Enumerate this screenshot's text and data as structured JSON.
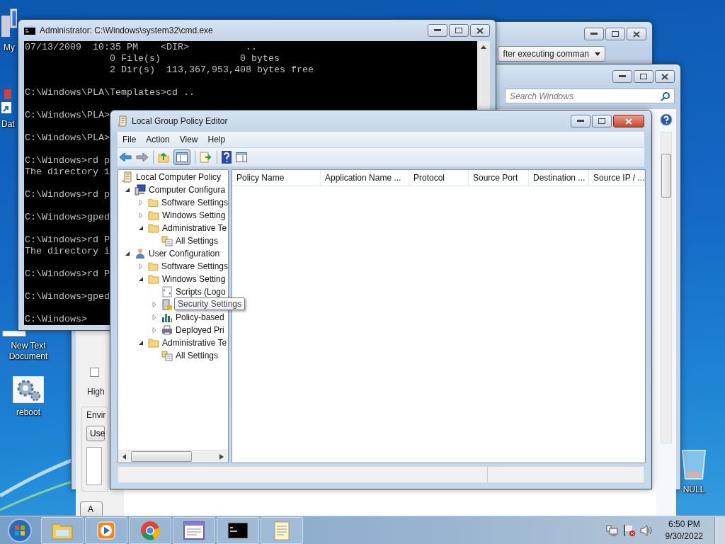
{
  "desktop_icons": [
    {
      "label": "My",
      "kind": "computer"
    },
    {
      "label": "Dat",
      "kind": "shortcut"
    },
    {
      "label": "New Text Document",
      "kind": "text"
    },
    {
      "label": "reboot",
      "kind": "gear"
    },
    {
      "label": "NULL",
      "kind": "bin"
    }
  ],
  "back_window_a": {
    "dropdown": "fter executing comman"
  },
  "back_window_b": {
    "search": {
      "placeholder": "Search Windows"
    },
    "checkbox": {
      "checked": false
    },
    "option_label": "High",
    "group_label": "Envir",
    "dropdown": "Use",
    "button": "A"
  },
  "cmd": {
    "title": "Administrator: C:\\Windows\\system32\\cmd.exe",
    "blocks": [
      [
        "07/13/2009  10:35 PM    <DIR>          ..",
        "               0 File(s)              0 bytes",
        "               2 Dir(s)  113,367,953,408 bytes free"
      ],
      [
        "C:\\Windows\\PLA\\Templates>cd .."
      ],
      [
        "C:\\Windows\\PLA>"
      ],
      [
        "C:\\Windows\\PLA>"
      ],
      [
        "C:\\Windows>rd p",
        "The directory i"
      ],
      [
        "C:\\Windows>rd p"
      ],
      [
        "C:\\Windows>gped"
      ],
      [
        "C:\\Windows>rd P",
        "The directory i"
      ],
      [
        "C:\\Windows>rd P"
      ],
      [
        "C:\\Windows>gped"
      ],
      [
        "C:\\Windows>"
      ]
    ]
  },
  "gpo": {
    "title": "Local Group Policy Editor",
    "menu": [
      "File",
      "Action",
      "View",
      "Help"
    ],
    "tree": [
      {
        "label": "Local Computer Policy",
        "kind": "policy",
        "children": [
          {
            "label": "Computer Configura",
            "kind": "computer",
            "expanded": true,
            "children": [
              {
                "label": "Software Settings",
                "kind": "folder",
                "expanded": false
              },
              {
                "label": "Windows Setting",
                "kind": "folder",
                "expanded": false
              },
              {
                "label": "Administrative Te",
                "kind": "folder",
                "expanded": true,
                "children": [
                  {
                    "label": "All Settings",
                    "kind": "settings"
                  }
                ]
              }
            ]
          },
          {
            "label": "User Configuration",
            "kind": "user",
            "expanded": true,
            "children": [
              {
                "label": "Software Settings",
                "kind": "folder",
                "expanded": false
              },
              {
                "label": "Windows Setting",
                "kind": "folder",
                "expanded": true,
                "children": [
                  {
                    "label": "Scripts (Logo",
                    "kind": "script"
                  },
                  {
                    "tooltip": "Security Settings",
                    "kind": "security",
                    "expanded": false
                  },
                  {
                    "label": "Policy-based",
                    "kind": "chart",
                    "expanded": false
                  },
                  {
                    "label": "Deployed Pri",
                    "kind": "printer",
                    "expanded": false
                  }
                ]
              },
              {
                "label": "Administrative Te",
                "kind": "folder",
                "expanded": true,
                "children": [
                  {
                    "label": "All Settings",
                    "kind": "settings"
                  }
                ]
              }
            ]
          }
        ]
      }
    ],
    "columns": [
      "Policy Name",
      "Application Name ...",
      "Protocol",
      "Source Port",
      "Destination ...",
      "Source IP / ..."
    ]
  },
  "taskbar": {
    "apps": [
      {
        "kind": "explorer"
      },
      {
        "kind": "media"
      },
      {
        "kind": "chrome"
      },
      {
        "kind": "gpedit"
      },
      {
        "kind": "cmd"
      },
      {
        "kind": "notepad"
      }
    ],
    "clock": {
      "time": "6:50 PM",
      "date": "9/30/2022"
    }
  }
}
